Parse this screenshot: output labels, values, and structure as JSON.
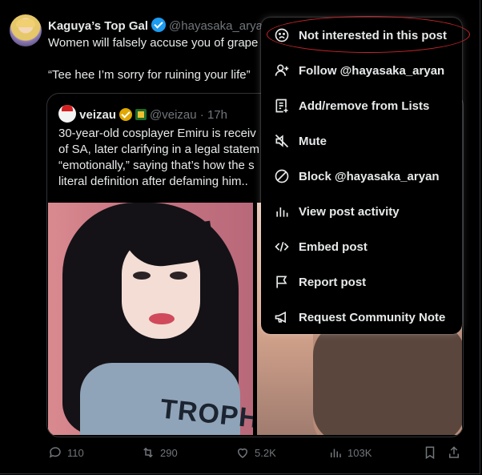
{
  "post": {
    "author_name": "Kaguya’s Top Gal",
    "author_handle": "@hayasaka_aryan",
    "text": "Women will falsely accuse you of grape\n\n“Tee hee I’m sorry for ruining your life”"
  },
  "quoted_post": {
    "author_name": "veizau",
    "author_handle": "@veizau",
    "time": "17h",
    "separator": "·",
    "text": "30-year-old cosplayer Emiru is receiv\nof SA, later clarifying in a legal statem\n“emotionally,” saying that’s how the s\nliteral definition after defaming him..",
    "image_left_text": "TROPHY"
  },
  "actions": {
    "replies": "110",
    "reposts": "290",
    "likes": "5.2K",
    "views": "103K"
  },
  "menu": {
    "items": [
      {
        "label": "Not interested in this post",
        "icon": "frown-icon"
      },
      {
        "label": "Follow @hayasaka_aryan",
        "icon": "follow-user-icon"
      },
      {
        "label": "Add/remove from Lists",
        "icon": "list-icon"
      },
      {
        "label": "Mute",
        "icon": "mute-icon"
      },
      {
        "label": "Block @hayasaka_aryan",
        "icon": "block-icon"
      },
      {
        "label": "View post activity",
        "icon": "activity-icon"
      },
      {
        "label": "Embed post",
        "icon": "embed-icon"
      },
      {
        "label": "Report post",
        "icon": "flag-icon"
      },
      {
        "label": "Request Community Note",
        "icon": "megaphone-icon"
      }
    ]
  },
  "colors": {
    "background": "#000000",
    "text": "#e7e9ea",
    "muted": "#71767b",
    "verified_blue": "#1d9bf0",
    "verified_gold": "#e0a800",
    "annotation_red": "#c8262b"
  }
}
